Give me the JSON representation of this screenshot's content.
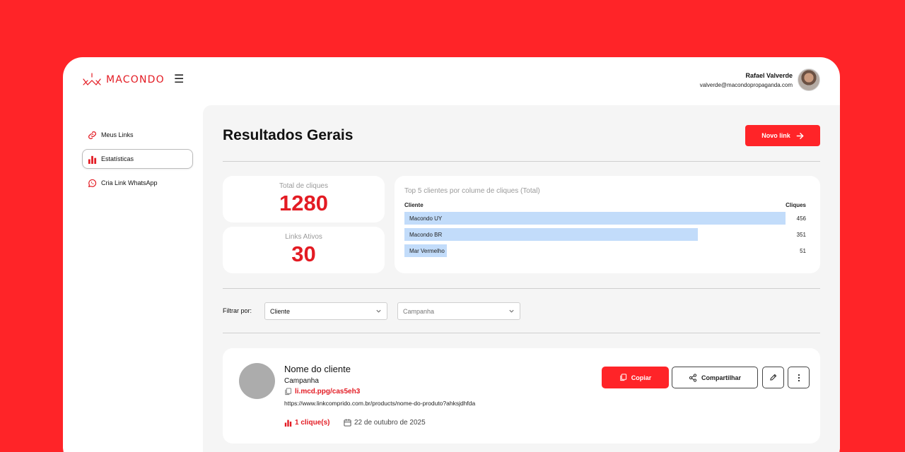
{
  "brand": {
    "name": "MACONDO",
    "accent": "#e31b23",
    "background": "#ff2428"
  },
  "header": {
    "menu_icon": "hamburger-icon",
    "user": {
      "name": "Rafael Valverde",
      "email": "valverde@macondopropaganda.com"
    }
  },
  "sidebar": {
    "items": [
      {
        "label": "Meus Links",
        "icon": "link-icon",
        "active": false
      },
      {
        "label": "Estatísticas",
        "icon": "bar-chart-icon",
        "active": true
      },
      {
        "label": "Cria Link WhatsApp",
        "icon": "whatsapp-icon",
        "active": false
      }
    ]
  },
  "main": {
    "title": "Resultados Gerais",
    "new_link_label": "Novo link",
    "stats": [
      {
        "label": "Total de cliques",
        "value": "1280"
      },
      {
        "label": "Links Ativos",
        "value": "30"
      }
    ],
    "filter": {
      "label": "Filtrar por:",
      "client_value": "Cliente",
      "campaign_placeholder": "Campanha"
    },
    "link_card": {
      "client_name": "Nome do cliente",
      "campaign": "Campanha",
      "short_link": "li.mcd.ppg/cas5eh3",
      "long_url": "https://www.linkcomprido.com.br/products/nome-do-produto?ahksjdhfda",
      "clicks": "1 clique(s)",
      "date": "22 de outubro de 2025",
      "copy_label": "Copiar",
      "share_label": "Compartilhar"
    }
  },
  "chart_data": {
    "type": "bar",
    "title": "Top 5 clientes por colume de cliques (Total)",
    "col_category": "Cliente",
    "col_value": "Cliques",
    "categories": [
      "Macondo UY",
      "Macondo BR",
      "Mar Vermelho"
    ],
    "values": [
      456,
      351,
      51
    ],
    "bar_color": "#c2dcfa",
    "orientation": "horizontal"
  }
}
